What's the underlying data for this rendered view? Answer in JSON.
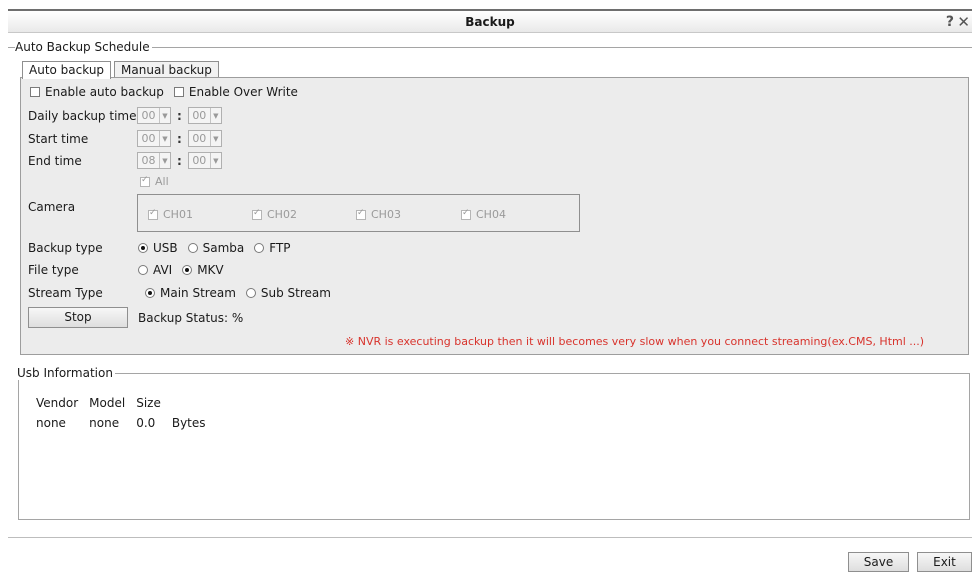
{
  "window": {
    "title": "Backup",
    "help_glyph": "?",
    "close_glyph": "✕"
  },
  "schedule": {
    "legend": "Auto Backup Schedule",
    "tabs": [
      "Auto backup",
      "Manual backup"
    ],
    "active_tab": "Auto backup",
    "enable_auto_backup": {
      "label": "Enable auto backup",
      "checked": false
    },
    "enable_over_write": {
      "label": "Enable Over Write",
      "checked": false
    },
    "daily_backup_time": {
      "label": "Daily backup time",
      "hour": "00",
      "minute": "00"
    },
    "start_time": {
      "label": "Start time",
      "hour": "00",
      "minute": "00"
    },
    "end_time": {
      "label": "End time",
      "hour": "08",
      "minute": "00"
    },
    "camera": {
      "label": "Camera",
      "all_label": "All",
      "channels": [
        "CH01",
        "CH02",
        "CH03",
        "CH04"
      ]
    },
    "backup_type": {
      "label": "Backup type",
      "options": [
        "USB",
        "Samba",
        "FTP"
      ],
      "selected": "USB"
    },
    "file_type": {
      "label": "File type",
      "options": [
        "AVI",
        "MKV"
      ],
      "selected": "MKV"
    },
    "stream_type": {
      "label": "Stream Type",
      "options": [
        "Main Stream",
        "Sub Stream"
      ],
      "selected": "Main Stream"
    },
    "stop_button": "Stop",
    "backup_status_label": "Backup Status:",
    "backup_status_value": "%",
    "warning": "※ NVR is executing backup then it will becomes very slow when you connect streaming(ex.CMS, Html ...)",
    "warning_color": "#d8332c"
  },
  "usb": {
    "legend": "Usb Information",
    "headers": [
      "Vendor",
      "Model",
      "Size"
    ],
    "row": [
      "none",
      "none",
      "0.0",
      "Bytes"
    ]
  },
  "footer": {
    "save": "Save",
    "exit": "Exit"
  }
}
